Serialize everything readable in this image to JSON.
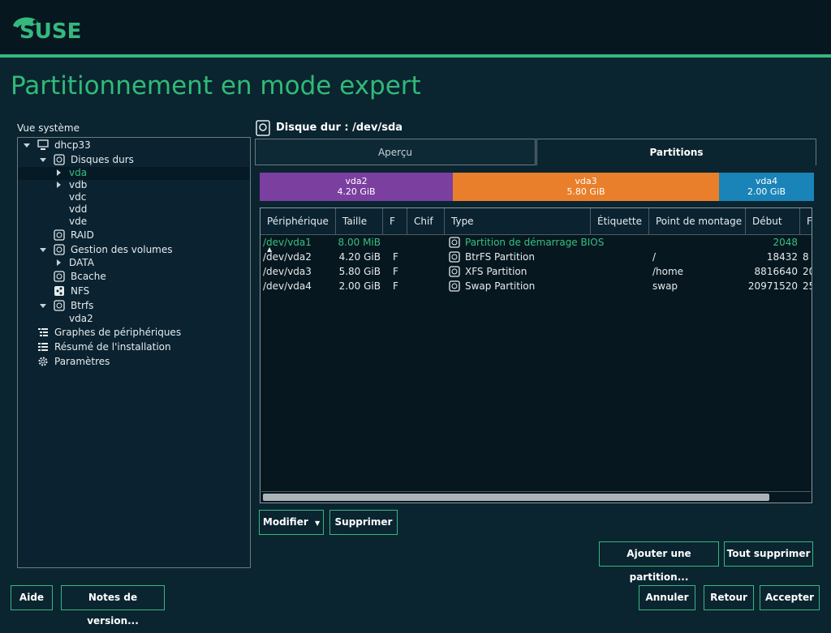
{
  "brand": {
    "logo_text": "SUSE"
  },
  "page_title": "Partitionnement en mode expert",
  "system_view_label": "Vue système",
  "tree": {
    "host": "dhcp33",
    "hard_disks": "Disques durs",
    "disks": [
      "vda",
      "vdb",
      "vdc",
      "vdd",
      "vde"
    ],
    "raid": "RAID",
    "volume_mgmt": "Gestion des volumes",
    "data": "DATA",
    "bcache": "Bcache",
    "nfs": "NFS",
    "btrfs": "Btrfs",
    "btrfs_child": "vda2",
    "device_graphs": "Graphes de périphériques",
    "install_summary": "Résumé de l'installation",
    "settings": "Paramètres"
  },
  "disk_header": "Disque dur : /dev/sda",
  "tabs": {
    "overview": "Aperçu",
    "partitions": "Partitions"
  },
  "bars": [
    {
      "name": "vda2",
      "size": "4.20 GiB",
      "color": "#7b3fa0"
    },
    {
      "name": "vda3",
      "size": "5.80 GiB",
      "color": "#e97f2b"
    },
    {
      "name": "vda4",
      "size": "2.00 GiB",
      "color": "#1a84b8"
    }
  ],
  "table": {
    "headers": [
      "Périphérique",
      "Taille",
      "F",
      "Chif",
      "Type",
      "Étiquette",
      "Point de montage",
      "Début",
      "F"
    ],
    "rows": [
      {
        "device": "/dev/vda1",
        "size": "8.00 MiB",
        "f": "",
        "type": "Partition de démarrage BIOS",
        "mount": "",
        "start": "2048",
        "end": ""
      },
      {
        "device": "/dev/vda2",
        "size": "4.20 GiB",
        "f": "F",
        "type": "BtrFS Partition",
        "mount": "/",
        "start": "18432",
        "end": "8"
      },
      {
        "device": "/dev/vda3",
        "size": "5.80 GiB",
        "f": "F",
        "type": "XFS Partition",
        "mount": "/home",
        "start": "8816640",
        "end": "20"
      },
      {
        "device": "/dev/vda4",
        "size": "2.00 GiB",
        "f": "F",
        "type": "Swap Partition",
        "mount": "swap",
        "start": "20971520",
        "end": "25"
      }
    ]
  },
  "buttons": {
    "modify": "Modifier",
    "delete": "Supprimer",
    "add_partition": "Ajouter une partition...",
    "delete_all": "Tout supprimer",
    "help": "Aide",
    "release_notes": "Notes de version...",
    "cancel": "Annuler",
    "back": "Retour",
    "accept": "Accepter"
  }
}
